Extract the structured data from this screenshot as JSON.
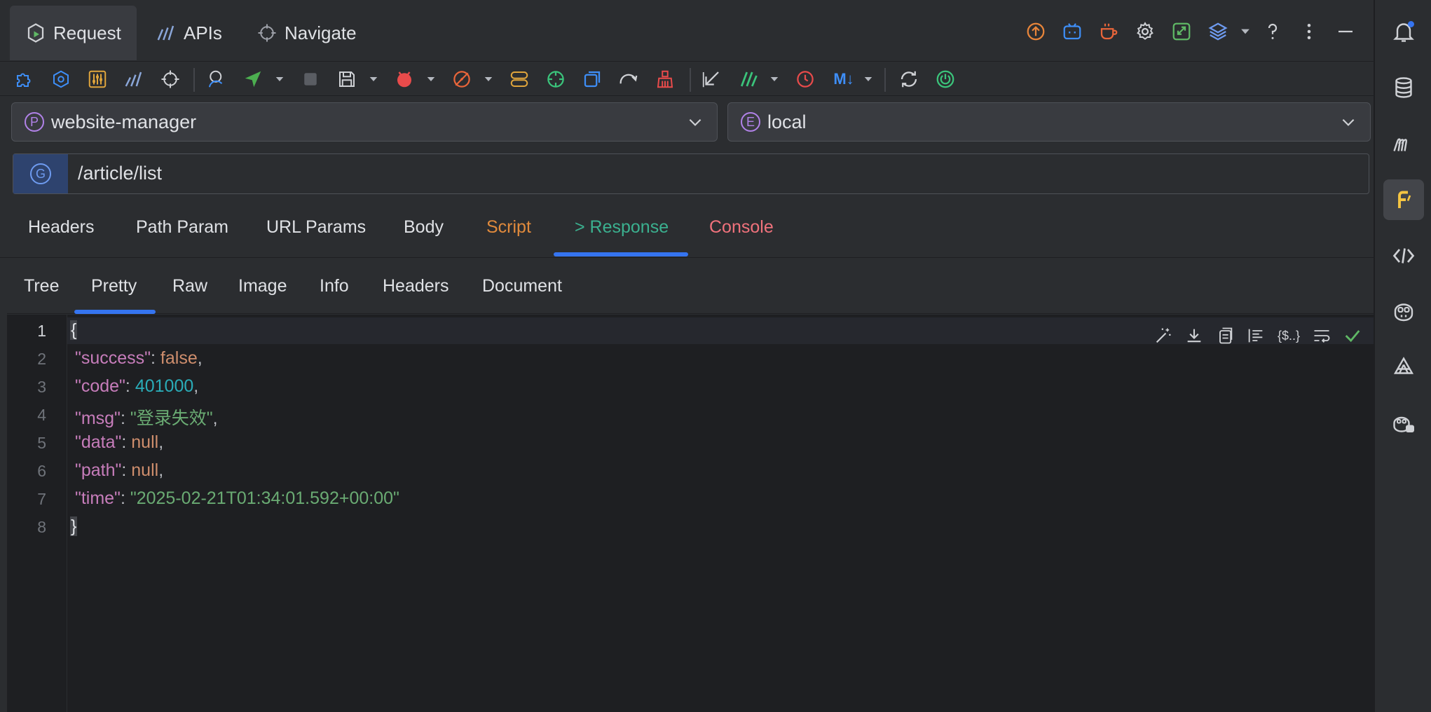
{
  "nav": {
    "tabs": [
      {
        "label": "Request"
      },
      {
        "label": "APIs"
      },
      {
        "label": "Navigate"
      }
    ]
  },
  "selectors": {
    "project": {
      "badge": "P",
      "value": "website-manager"
    },
    "environment": {
      "badge": "E",
      "value": "local"
    }
  },
  "request": {
    "method_badge": "G",
    "url": "/article/list"
  },
  "section_tabs": [
    {
      "label": "Headers",
      "color": "#dfe1e5"
    },
    {
      "label": "Path Param",
      "color": "#dfe1e5"
    },
    {
      "label": "URL Params",
      "color": "#dfe1e5"
    },
    {
      "label": "Body",
      "color": "#dfe1e5"
    },
    {
      "label": "Script",
      "color": "#e08a3c"
    },
    {
      "label": "> Response",
      "color": "#3bb08f"
    },
    {
      "label": "Console",
      "color": "#f0727c"
    }
  ],
  "response_tabs": [
    {
      "label": "Tree"
    },
    {
      "label": "Pretty"
    },
    {
      "label": "Raw"
    },
    {
      "label": "Image"
    },
    {
      "label": "Info"
    },
    {
      "label": "Headers"
    },
    {
      "label": "Document"
    }
  ],
  "editor": {
    "line_numbers": [
      "1",
      "2",
      "3",
      "4",
      "5",
      "6",
      "7",
      "8"
    ],
    "json": {
      "open": "{",
      "close": "}",
      "success_key": "\"success\"",
      "success_val": "false",
      "code_key": "\"code\"",
      "code_val": "401000",
      "msg_key": "\"msg\"",
      "msg_val": "\"登录失效\"",
      "data_key": "\"data\"",
      "data_val": "null",
      "path_key": "\"path\"",
      "path_val": "null",
      "time_key": "\"time\"",
      "time_val": "\"2025-02-21T01:34:01.592+00:00\""
    },
    "tool_labels": {
      "env_var": "{$..}"
    }
  },
  "toolbar": {
    "markdown_label": "M↓"
  },
  "colors": {
    "accent": "#3574f0",
    "response_tab": "#3bb08f",
    "script_tab": "#e08a3c",
    "console_tab": "#f0727c"
  }
}
